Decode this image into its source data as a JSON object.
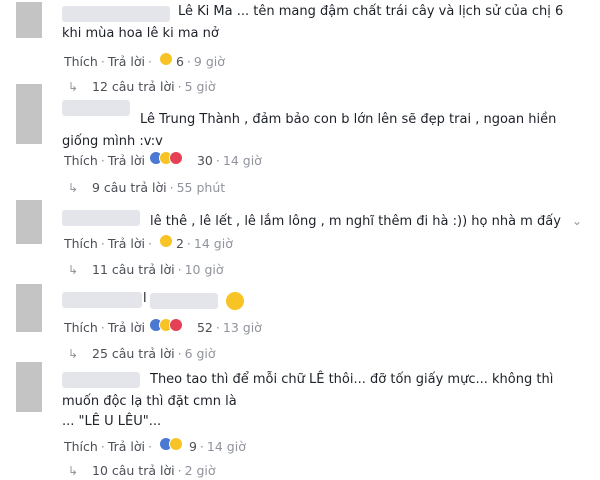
{
  "comments": [
    {
      "text_lines": [
        "Lê Ki Ma ... tên mang đậm chất trái cây và lịch sử của chị 6",
        "khi mùa hoa lê ki ma nở"
      ],
      "like_label": "Thích",
      "reply_label": "Trả lời",
      "reaction_icons": [
        "haha-icon"
      ],
      "reaction_count": "6",
      "time": "9 giờ",
      "replies_label": "12 câu trả lời",
      "replies_time": "5 giờ"
    },
    {
      "text_lines": [
        "Lê Trung Thành , đảm bảo con b lớn lên sẽ đẹp trai , ngoan hiền",
        "giống mình :v:v"
      ],
      "like_label": "Thích",
      "reply_label": "Trả lời",
      "reaction_icons": [
        "like-icon",
        "haha-icon",
        "love-icon"
      ],
      "reaction_count": "30",
      "time": "14 giờ",
      "replies_label": "9 câu trả lời",
      "replies_time": "55 phút"
    },
    {
      "text_lines": [
        "lê thê , lê lết , lê lắm lông , m nghĩ thêm đi hà :)) họ nhà m đấy"
      ],
      "like_label": "Thích",
      "reply_label": "Trả lời",
      "reaction_icons": [
        "haha-icon"
      ],
      "reaction_count": "2",
      "time": "14 giờ",
      "replies_label": "11 câu trả lời",
      "replies_time": "10 giờ"
    },
    {
      "text_lines": [
        "l"
      ],
      "like_label": "Thích",
      "reply_label": "Trả lời",
      "reaction_icons": [
        "like-icon",
        "haha-icon",
        "love-icon"
      ],
      "reaction_count": "52",
      "time": "13 giờ",
      "replies_label": "25 câu trả lời",
      "replies_time": "6 giờ"
    },
    {
      "text_lines": [
        "Theo tao thì để mỗi chữ LÊ thôi... đỡ tốn giấy mực... không thì",
        "muốn độc lạ thì đặt cmn là",
        "... \"LÊ U LÊU\"..."
      ],
      "like_label": "Thích",
      "reply_label": "Trả lời",
      "reaction_icons": [
        "like-icon",
        "haha-icon"
      ],
      "reaction_count": "9",
      "time": "14 giờ",
      "replies_label": "10 câu trả lời",
      "replies_time": "2 giờ"
    }
  ],
  "colors": {
    "like": "#4b78d0",
    "haha": "#f7c325",
    "love": "#e54055",
    "text": "#1d2129",
    "meta": "#90949c"
  }
}
